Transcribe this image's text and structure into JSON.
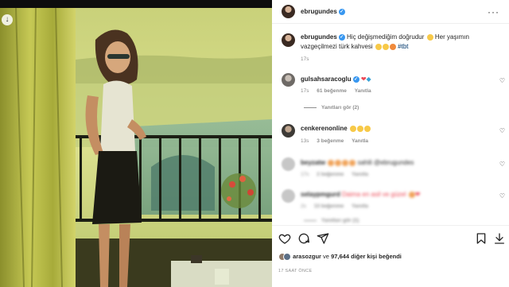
{
  "post": {
    "username": "ebrugundes",
    "verified_mark": "✓"
  },
  "caption": {
    "username": "ebrugundes",
    "text_line1": "Hiç değişmediğim doğrudur",
    "text_line2": "Her yaşımın",
    "text_line3": "vazgeçilmezi türk kahvesi",
    "hashtag": "#tbt",
    "time": "17s"
  },
  "comments": [
    {
      "username": "gulsahsaracoglu",
      "time": "17s",
      "likes": "61 beğenme",
      "reply": "Yanıtla",
      "view_replies": "Yanıtları gör (2)"
    },
    {
      "username": "cenkerenonline",
      "time": "13s",
      "likes": "3 beğenme",
      "reply": "Yanıtla"
    }
  ],
  "blurred_comments": [
    {
      "username": "beyzatw",
      "text": "sahili @ebrugundes",
      "time": "17s",
      "likes": "2 beğenme",
      "reply": "Yanıtla"
    },
    {
      "username": "selaypmgurd",
      "text": "Daima en asil ve güzel",
      "time": "2s",
      "likes": "13 beğenme",
      "reply": "Yanıtla"
    },
    {
      "view_replies": "Yanıtları gör (1)"
    }
  ],
  "likes": {
    "user": "arasozgur",
    "connector": "ve",
    "count": "97,644",
    "suffix": "diğer kişi beğendi"
  },
  "timestamp": "17 SAAT ÖNCE",
  "icons": {
    "header_more": "more-options-icon",
    "like": "heart-icon",
    "comment": "comment-icon",
    "share": "share-icon",
    "save": "bookmark-icon",
    "download": "download-icon"
  },
  "colors": {
    "verified": "#3897f0",
    "hashtag": "#00376b",
    "muted": "#8e8e8e",
    "heart": "#ed4956"
  }
}
